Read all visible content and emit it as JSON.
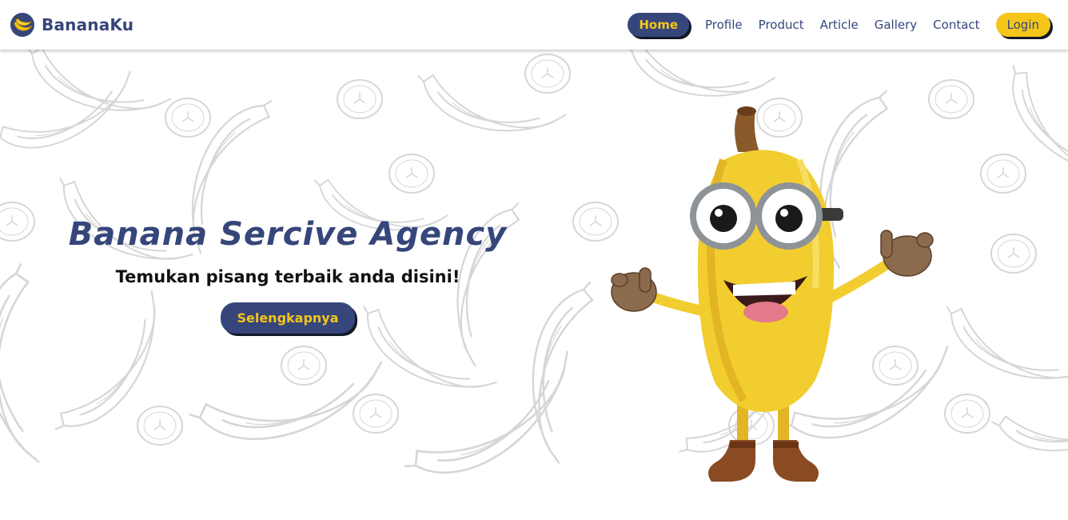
{
  "brand": {
    "name": "BananaKu",
    "logo_icon": "banana-logo-icon"
  },
  "nav": {
    "items": [
      {
        "label": "Home",
        "active": true
      },
      {
        "label": "Profile"
      },
      {
        "label": "Product"
      },
      {
        "label": "Article"
      },
      {
        "label": "Gallery"
      },
      {
        "label": "Contact"
      }
    ],
    "login_label": "Login"
  },
  "hero": {
    "title": "Banana Sercive Agency",
    "subtitle": "Temukan pisang terbaik anda disini!",
    "button_label": "Selengkapnya",
    "mascot_icon": "banana-mascot-illustration",
    "background_icon": "banana-sketch-pattern"
  },
  "colors": {
    "primary": "#36467a",
    "accent": "#f5c51a",
    "text_dark": "#111111",
    "background": "#ffffff"
  }
}
